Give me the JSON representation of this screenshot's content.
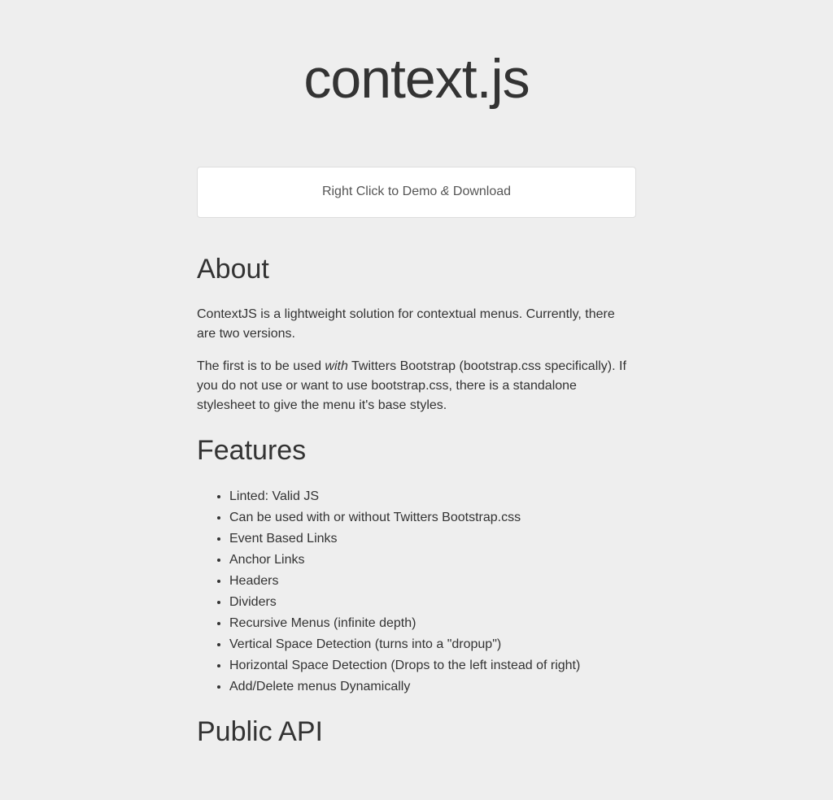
{
  "header": {
    "title": "context.js"
  },
  "demo_box": {
    "text_before": "Right Click to Demo ",
    "text_ampersand": "&",
    "text_after": " Download"
  },
  "about": {
    "heading": "About",
    "paragraph1": "ContextJS is a lightweight solution for contextual menus. Currently, there are two versions.",
    "paragraph2_before": "The first is to be used ",
    "paragraph2_italic": "with",
    "paragraph2_after": " Twitters Bootstrap (bootstrap.css specifically). If you do not use or want to use bootstrap.css, there is a standalone stylesheet to give the menu it's base styles."
  },
  "features": {
    "heading": "Features",
    "items": [
      "Linted: Valid JS",
      "Can be used with or without Twitters Bootstrap.css",
      "Event Based Links",
      "Anchor Links",
      "Headers",
      "Dividers",
      "Recursive Menus (infinite depth)",
      "Vertical Space Detection (turns into a \"dropup\")",
      "Horizontal Space Detection (Drops to the left instead of right)",
      "Add/Delete menus Dynamically"
    ]
  },
  "public_api": {
    "heading": "Public API"
  }
}
